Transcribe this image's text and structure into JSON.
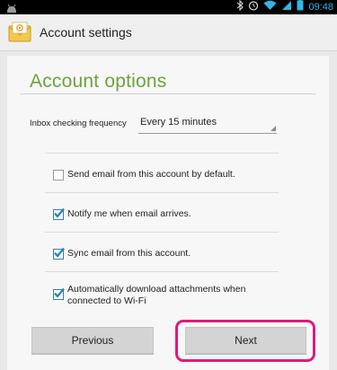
{
  "status_bar": {
    "time": "09:48",
    "icons": [
      "android-icon",
      "bluetooth-icon",
      "alarm-icon",
      "wifi-icon",
      "signal-icon",
      "battery-icon"
    ]
  },
  "action_bar": {
    "title": "Account settings",
    "icon": "email-app-icon"
  },
  "main": {
    "section_title": "Account options",
    "frequency": {
      "label": "Inbox checking frequency",
      "value": "Every 15 minutes"
    },
    "options": [
      {
        "label": "Send email from this account by default.",
        "checked": false
      },
      {
        "label": "Notify me when email arrives.",
        "checked": true
      },
      {
        "label": "Sync email from this account.",
        "checked": true
      },
      {
        "label_line1": "Automatically download attachments when",
        "label_line2": "connected to Wi-Fi",
        "checked": true
      }
    ]
  },
  "buttons": {
    "previous_label": "Previous",
    "next_label": "Next"
  },
  "colors": {
    "accent_green": "#6aa43a",
    "checkbox_blue": "#2f7fb6",
    "highlight_pink": "#e0197a",
    "time_blue": "#33b5e5"
  }
}
